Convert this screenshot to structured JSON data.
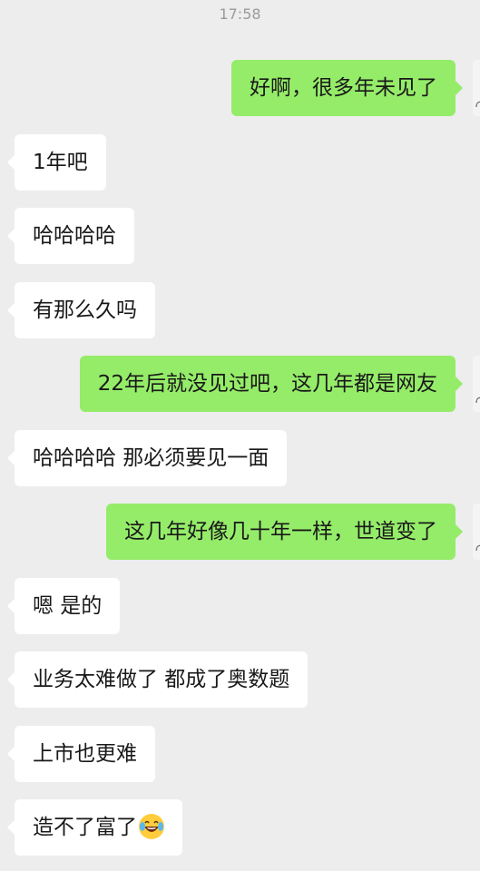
{
  "timestamp": "17:58",
  "messages": [
    {
      "side": "out",
      "text": "好啊，很多年未见了"
    },
    {
      "side": "in",
      "text": "1年吧"
    },
    {
      "side": "in",
      "text": "哈哈哈哈"
    },
    {
      "side": "in",
      "text": "有那么久吗"
    },
    {
      "side": "out",
      "text": "22年后就没见过吧，这几年都是网友"
    },
    {
      "side": "in",
      "text": "哈哈哈哈 那必须要见一面"
    },
    {
      "side": "out",
      "text": "这几年好像几十年一样，世道变了"
    },
    {
      "side": "in",
      "text": "嗯 是的"
    },
    {
      "side": "in",
      "text": "业务太难做了 都成了奥数题"
    },
    {
      "side": "in",
      "text": "上市也更难"
    },
    {
      "side": "in",
      "text": "造不了富了",
      "emoji": "laughing-tears-emoji"
    }
  ],
  "colors": {
    "background": "#ededed",
    "incoming_bubble": "#ffffff",
    "outgoing_bubble": "#95ec69",
    "text": "#191919",
    "timestamp": "#9a9a9a"
  }
}
